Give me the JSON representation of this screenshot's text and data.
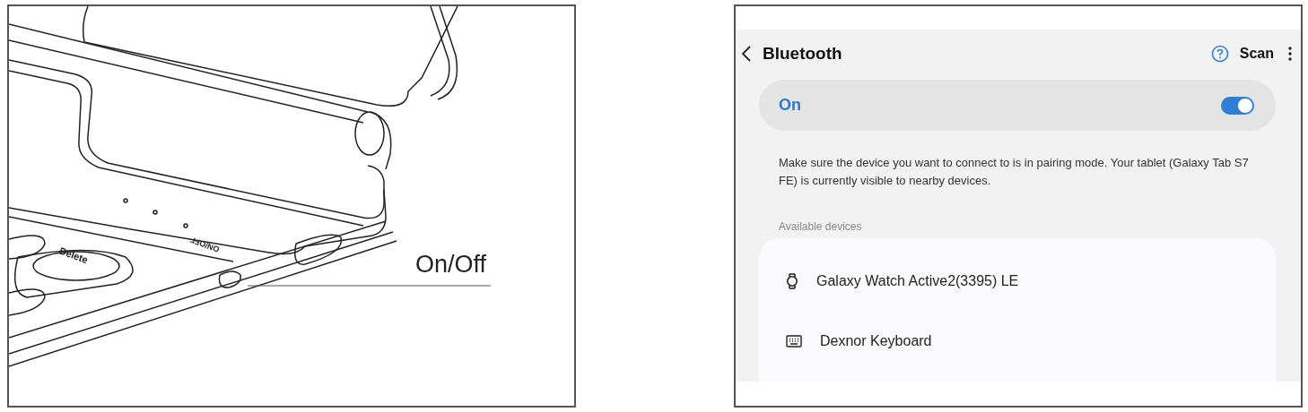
{
  "figure": {
    "callout": "On/Off",
    "key_label": "Delete",
    "switch_label": "ON/OFF"
  },
  "screen": {
    "title": "Bluetooth",
    "scan": "Scan",
    "master_switch": {
      "label": "On",
      "on": true
    },
    "description": "Make sure the device you want to connect to is in pairing mode. Your tablet (Galaxy Tab S7 FE) is currently visible to nearby devices.",
    "section_header": "Available devices",
    "devices": [
      {
        "name": "Galaxy Watch Active2(3395) LE",
        "kind": "watch"
      },
      {
        "name": "Dexnor Keyboard",
        "kind": "keyboard"
      }
    ]
  }
}
